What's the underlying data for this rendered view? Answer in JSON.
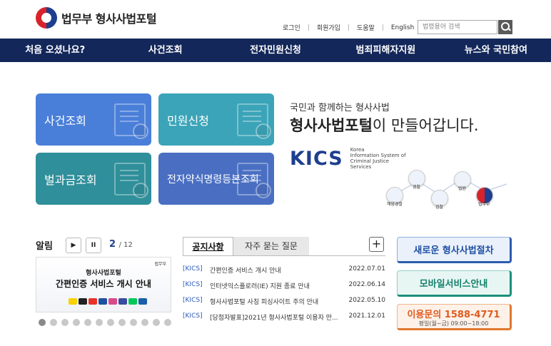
{
  "header": {
    "logo_text": "법무부 형사사법포털",
    "util_links": [
      "로그인",
      "회원가입",
      "도움말",
      "English"
    ],
    "search_placeholder": "법령용어 검색"
  },
  "nav": [
    "처음 오셨나요?",
    "사건조회",
    "전자민원신청",
    "범죄피해자지원",
    "뉴스와 국민참여"
  ],
  "tiles": [
    "사건조회",
    "민원신청",
    "벌과금조회",
    "전자약식명령등본조회"
  ],
  "promo": {
    "line1": "국민과 함께하는 형사사법",
    "line2_bold": "형사사법포털",
    "line2_rest": "이 만들어갑니다.",
    "kics": "KICS",
    "kics_desc": [
      "Korea",
      "Information System of",
      "Criminal Justice",
      "Services"
    ],
    "orgs": [
      "경찰",
      "법원",
      "해양경찰",
      "검찰",
      "법무부"
    ]
  },
  "alarm": {
    "title": "알림",
    "play_icon": "▶",
    "pause_icon": "II",
    "current": "2",
    "total": "/ 12",
    "banner_small": "법무부",
    "banner_title": "형사사법포털",
    "banner_subtitle": "간편인증 서비스 개시 안내"
  },
  "notice": {
    "tabs": [
      "공지사항",
      "자주 묻는 질문"
    ],
    "plus": "+",
    "rows": [
      {
        "tag": "[KICS]",
        "title": "간편인증 서비스 개시 안내",
        "date": "2022.07.01"
      },
      {
        "tag": "[KICS]",
        "title": "인터넷익스플로러(IE) 지원 종료 안내",
        "date": "2022.06.14"
      },
      {
        "tag": "[KICS]",
        "title": "형사사법포털 사칭 피싱사이트 주의 안내",
        "date": "2022.05.10"
      },
      {
        "tag": "[KICS]",
        "title": "[당첨자발표]2021년 형사사법포털 이용자 만...",
        "date": "2021.12.01"
      }
    ]
  },
  "quick": {
    "new_procedure": "새로운 형사사법절차",
    "mobile": "모바일서비스안내",
    "inquiry": "이용문의 1588-4771",
    "hours": "평일(월~금) 09:00~18:00"
  },
  "colors": {
    "nav_bg": "#13275a",
    "tile1": "#4a7fd9",
    "tile2": "#3ba4b8",
    "tile3": "#2f8f9a",
    "tile4": "#4a6fc2",
    "accent_blue": "#1e3f8f",
    "accent_orange": "#e05a1e"
  }
}
